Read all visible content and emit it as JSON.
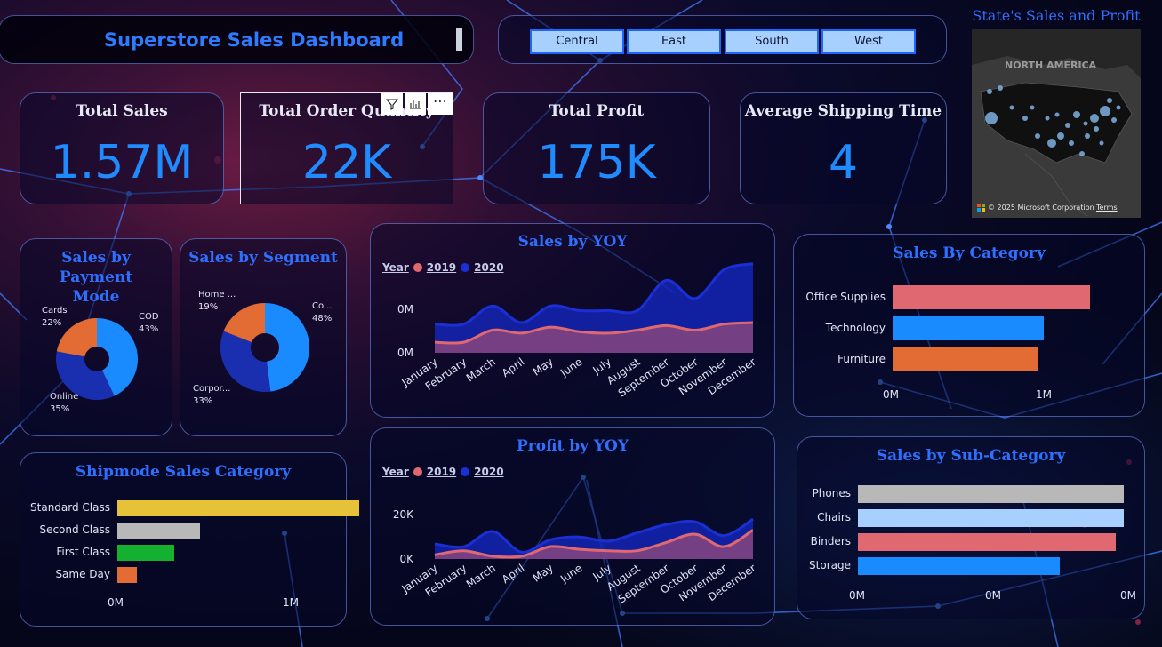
{
  "header": {
    "title": "Superstore Sales Dashboard"
  },
  "region_slicer": {
    "items": [
      "Central",
      "East",
      "South",
      "West"
    ]
  },
  "kpis": {
    "total_sales": {
      "label": "Total Sales",
      "value": "1.57M"
    },
    "total_order_quantity": {
      "label": "Total Order Quantity",
      "value": "22K"
    },
    "total_profit": {
      "label": "Total Profit",
      "value": "175K"
    },
    "avg_shipping_time": {
      "label": "Average Shipping Time",
      "value": "4"
    }
  },
  "map": {
    "title": "State's Sales and Profit",
    "region_label": "NORTH AMERICA",
    "attribution": "© 2025 Microsoft Corporation",
    "terms": "Terms"
  },
  "colors": {
    "accent": "#1f8bff",
    "title_blue": "#2f6fff",
    "series_2019": "#e06870",
    "series_2020": "#1a2fd6",
    "orange": "#e36c35"
  },
  "chart_data": [
    {
      "id": "payment_mode",
      "type": "pie",
      "title": "Sales by Payment Mode",
      "categories": [
        "COD",
        "Online",
        "Cards"
      ],
      "labels": [
        "COD",
        "Online",
        "Cards"
      ],
      "pct_labels": [
        "43%",
        "35%",
        "22%"
      ],
      "values": [
        43,
        35,
        22
      ],
      "colors": [
        "#1a8bff",
        "#1a2fb0",
        "#e36c35"
      ]
    },
    {
      "id": "segment",
      "type": "pie",
      "title": "Sales by Segment",
      "categories": [
        "Co...",
        "Corpor...",
        "Home ..."
      ],
      "labels": [
        "Co...",
        "Corpor...",
        "Home ..."
      ],
      "pct_labels": [
        "48%",
        "33%",
        "19%"
      ],
      "values": [
        48,
        33,
        19
      ],
      "colors": [
        "#1a8bff",
        "#1a2fb0",
        "#e36c35"
      ]
    },
    {
      "id": "sales_yoy",
      "type": "area",
      "title": "Sales by YOY",
      "legend_title": "Year",
      "categories": [
        "January",
        "February",
        "March",
        "April",
        "May",
        "June",
        "July",
        "August",
        "September",
        "October",
        "November",
        "December"
      ],
      "series": [
        {
          "name": "2019",
          "values": [
            14,
            14,
            30,
            26,
            34,
            28,
            26,
            30,
            36,
            30,
            38,
            40
          ]
        },
        {
          "name": "2020",
          "values": [
            38,
            38,
            62,
            40,
            62,
            56,
            56,
            56,
            96,
            72,
            110,
            118
          ]
        }
      ],
      "ytick_labels": [
        "0M",
        "0M"
      ]
    },
    {
      "id": "profit_yoy",
      "type": "area",
      "title": "Profit by YOY",
      "legend_title": "Year",
      "categories": [
        "January",
        "February",
        "March",
        "April",
        "May",
        "June",
        "July",
        "August",
        "September",
        "October",
        "November",
        "December"
      ],
      "series": [
        {
          "name": "2019",
          "values": [
            3,
            6,
            2,
            2,
            9,
            7,
            6,
            6,
            12,
            18,
            9,
            21
          ]
        },
        {
          "name": "2020",
          "values": [
            11,
            9,
            20,
            5,
            14,
            16,
            13,
            19,
            25,
            27,
            17,
            29
          ]
        }
      ],
      "ytick_labels": [
        "0K",
        "20K"
      ]
    },
    {
      "id": "category",
      "type": "bar",
      "title": "Sales By Category",
      "categories": [
        "Office Supplies",
        "Technology",
        "Furniture"
      ],
      "values": [
        0.6,
        0.46,
        0.44
      ],
      "colors": [
        "#e06870",
        "#1a8bff",
        "#e36c35"
      ],
      "xtick_labels": [
        "0M",
        "1M"
      ]
    },
    {
      "id": "shipmode",
      "type": "bar",
      "title": "Shipmode Sales Category",
      "categories": [
        "Standard Class",
        "Second Class",
        "First Class",
        "Same Day"
      ],
      "values": [
        0.85,
        0.29,
        0.2,
        0.07
      ],
      "colors": [
        "#e5c237",
        "#b8b8b8",
        "#14b030",
        "#e36c35"
      ],
      "xtick_labels": [
        "0M",
        "1M"
      ]
    },
    {
      "id": "subcategory",
      "type": "bar",
      "title": "Sales by Sub-Category",
      "categories": [
        "Phones",
        "Chairs",
        "Binders",
        "Storage"
      ],
      "values": [
        0.33,
        0.33,
        0.32,
        0.25
      ],
      "colors": [
        "#b8b8b8",
        "#a8d0ff",
        "#e06870",
        "#1a8bff"
      ],
      "xtick_labels": [
        "0M",
        "0M",
        "0M"
      ]
    }
  ]
}
